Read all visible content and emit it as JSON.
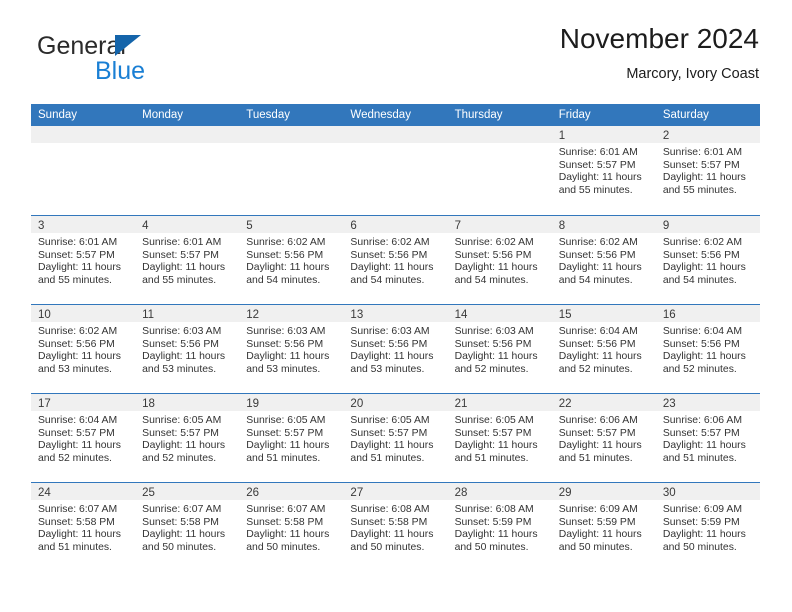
{
  "brand": {
    "name_part1": "General",
    "name_part2": "Blue",
    "triangle_color": "#1464aa",
    "blue_color": "#1a7fd4"
  },
  "header": {
    "title": "November 2024",
    "subtitle": "Marcory, Ivory Coast"
  },
  "theme": {
    "header_blue": "#3277bc",
    "daynum_band": "#f0f0f0",
    "text": "#333333"
  },
  "calendar": {
    "weekday_headers": [
      "Sunday",
      "Monday",
      "Tuesday",
      "Wednesday",
      "Thursday",
      "Friday",
      "Saturday"
    ],
    "weeks": [
      [
        {
          "day": "",
          "empty": true,
          "line1": "",
          "line2": "",
          "line3": "",
          "line4": ""
        },
        {
          "day": "",
          "empty": true,
          "line1": "",
          "line2": "",
          "line3": "",
          "line4": ""
        },
        {
          "day": "",
          "empty": true,
          "line1": "",
          "line2": "",
          "line3": "",
          "line4": ""
        },
        {
          "day": "",
          "empty": true,
          "line1": "",
          "line2": "",
          "line3": "",
          "line4": ""
        },
        {
          "day": "",
          "empty": true,
          "line1": "",
          "line2": "",
          "line3": "",
          "line4": ""
        },
        {
          "day": "1",
          "empty": false,
          "line1": "Sunrise: 6:01 AM",
          "line2": "Sunset: 5:57 PM",
          "line3": "Daylight: 11 hours",
          "line4": "and 55 minutes."
        },
        {
          "day": "2",
          "empty": false,
          "line1": "Sunrise: 6:01 AM",
          "line2": "Sunset: 5:57 PM",
          "line3": "Daylight: 11 hours",
          "line4": "and 55 minutes."
        }
      ],
      [
        {
          "day": "3",
          "empty": false,
          "line1": "Sunrise: 6:01 AM",
          "line2": "Sunset: 5:57 PM",
          "line3": "Daylight: 11 hours",
          "line4": "and 55 minutes."
        },
        {
          "day": "4",
          "empty": false,
          "line1": "Sunrise: 6:01 AM",
          "line2": "Sunset: 5:57 PM",
          "line3": "Daylight: 11 hours",
          "line4": "and 55 minutes."
        },
        {
          "day": "5",
          "empty": false,
          "line1": "Sunrise: 6:02 AM",
          "line2": "Sunset: 5:56 PM",
          "line3": "Daylight: 11 hours",
          "line4": "and 54 minutes."
        },
        {
          "day": "6",
          "empty": false,
          "line1": "Sunrise: 6:02 AM",
          "line2": "Sunset: 5:56 PM",
          "line3": "Daylight: 11 hours",
          "line4": "and 54 minutes."
        },
        {
          "day": "7",
          "empty": false,
          "line1": "Sunrise: 6:02 AM",
          "line2": "Sunset: 5:56 PM",
          "line3": "Daylight: 11 hours",
          "line4": "and 54 minutes."
        },
        {
          "day": "8",
          "empty": false,
          "line1": "Sunrise: 6:02 AM",
          "line2": "Sunset: 5:56 PM",
          "line3": "Daylight: 11 hours",
          "line4": "and 54 minutes."
        },
        {
          "day": "9",
          "empty": false,
          "line1": "Sunrise: 6:02 AM",
          "line2": "Sunset: 5:56 PM",
          "line3": "Daylight: 11 hours",
          "line4": "and 54 minutes."
        }
      ],
      [
        {
          "day": "10",
          "empty": false,
          "line1": "Sunrise: 6:02 AM",
          "line2": "Sunset: 5:56 PM",
          "line3": "Daylight: 11 hours",
          "line4": "and 53 minutes."
        },
        {
          "day": "11",
          "empty": false,
          "line1": "Sunrise: 6:03 AM",
          "line2": "Sunset: 5:56 PM",
          "line3": "Daylight: 11 hours",
          "line4": "and 53 minutes."
        },
        {
          "day": "12",
          "empty": false,
          "line1": "Sunrise: 6:03 AM",
          "line2": "Sunset: 5:56 PM",
          "line3": "Daylight: 11 hours",
          "line4": "and 53 minutes."
        },
        {
          "day": "13",
          "empty": false,
          "line1": "Sunrise: 6:03 AM",
          "line2": "Sunset: 5:56 PM",
          "line3": "Daylight: 11 hours",
          "line4": "and 53 minutes."
        },
        {
          "day": "14",
          "empty": false,
          "line1": "Sunrise: 6:03 AM",
          "line2": "Sunset: 5:56 PM",
          "line3": "Daylight: 11 hours",
          "line4": "and 52 minutes."
        },
        {
          "day": "15",
          "empty": false,
          "line1": "Sunrise: 6:04 AM",
          "line2": "Sunset: 5:56 PM",
          "line3": "Daylight: 11 hours",
          "line4": "and 52 minutes."
        },
        {
          "day": "16",
          "empty": false,
          "line1": "Sunrise: 6:04 AM",
          "line2": "Sunset: 5:56 PM",
          "line3": "Daylight: 11 hours",
          "line4": "and 52 minutes."
        }
      ],
      [
        {
          "day": "17",
          "empty": false,
          "line1": "Sunrise: 6:04 AM",
          "line2": "Sunset: 5:57 PM",
          "line3": "Daylight: 11 hours",
          "line4": "and 52 minutes."
        },
        {
          "day": "18",
          "empty": false,
          "line1": "Sunrise: 6:05 AM",
          "line2": "Sunset: 5:57 PM",
          "line3": "Daylight: 11 hours",
          "line4": "and 52 minutes."
        },
        {
          "day": "19",
          "empty": false,
          "line1": "Sunrise: 6:05 AM",
          "line2": "Sunset: 5:57 PM",
          "line3": "Daylight: 11 hours",
          "line4": "and 51 minutes."
        },
        {
          "day": "20",
          "empty": false,
          "line1": "Sunrise: 6:05 AM",
          "line2": "Sunset: 5:57 PM",
          "line3": "Daylight: 11 hours",
          "line4": "and 51 minutes."
        },
        {
          "day": "21",
          "empty": false,
          "line1": "Sunrise: 6:05 AM",
          "line2": "Sunset: 5:57 PM",
          "line3": "Daylight: 11 hours",
          "line4": "and 51 minutes."
        },
        {
          "day": "22",
          "empty": false,
          "line1": "Sunrise: 6:06 AM",
          "line2": "Sunset: 5:57 PM",
          "line3": "Daylight: 11 hours",
          "line4": "and 51 minutes."
        },
        {
          "day": "23",
          "empty": false,
          "line1": "Sunrise: 6:06 AM",
          "line2": "Sunset: 5:57 PM",
          "line3": "Daylight: 11 hours",
          "line4": "and 51 minutes."
        }
      ],
      [
        {
          "day": "24",
          "empty": false,
          "line1": "Sunrise: 6:07 AM",
          "line2": "Sunset: 5:58 PM",
          "line3": "Daylight: 11 hours",
          "line4": "and 51 minutes."
        },
        {
          "day": "25",
          "empty": false,
          "line1": "Sunrise: 6:07 AM",
          "line2": "Sunset: 5:58 PM",
          "line3": "Daylight: 11 hours",
          "line4": "and 50 minutes."
        },
        {
          "day": "26",
          "empty": false,
          "line1": "Sunrise: 6:07 AM",
          "line2": "Sunset: 5:58 PM",
          "line3": "Daylight: 11 hours",
          "line4": "and 50 minutes."
        },
        {
          "day": "27",
          "empty": false,
          "line1": "Sunrise: 6:08 AM",
          "line2": "Sunset: 5:58 PM",
          "line3": "Daylight: 11 hours",
          "line4": "and 50 minutes."
        },
        {
          "day": "28",
          "empty": false,
          "line1": "Sunrise: 6:08 AM",
          "line2": "Sunset: 5:59 PM",
          "line3": "Daylight: 11 hours",
          "line4": "and 50 minutes."
        },
        {
          "day": "29",
          "empty": false,
          "line1": "Sunrise: 6:09 AM",
          "line2": "Sunset: 5:59 PM",
          "line3": "Daylight: 11 hours",
          "line4": "and 50 minutes."
        },
        {
          "day": "30",
          "empty": false,
          "line1": "Sunrise: 6:09 AM",
          "line2": "Sunset: 5:59 PM",
          "line3": "Daylight: 11 hours",
          "line4": "and 50 minutes."
        }
      ]
    ]
  }
}
